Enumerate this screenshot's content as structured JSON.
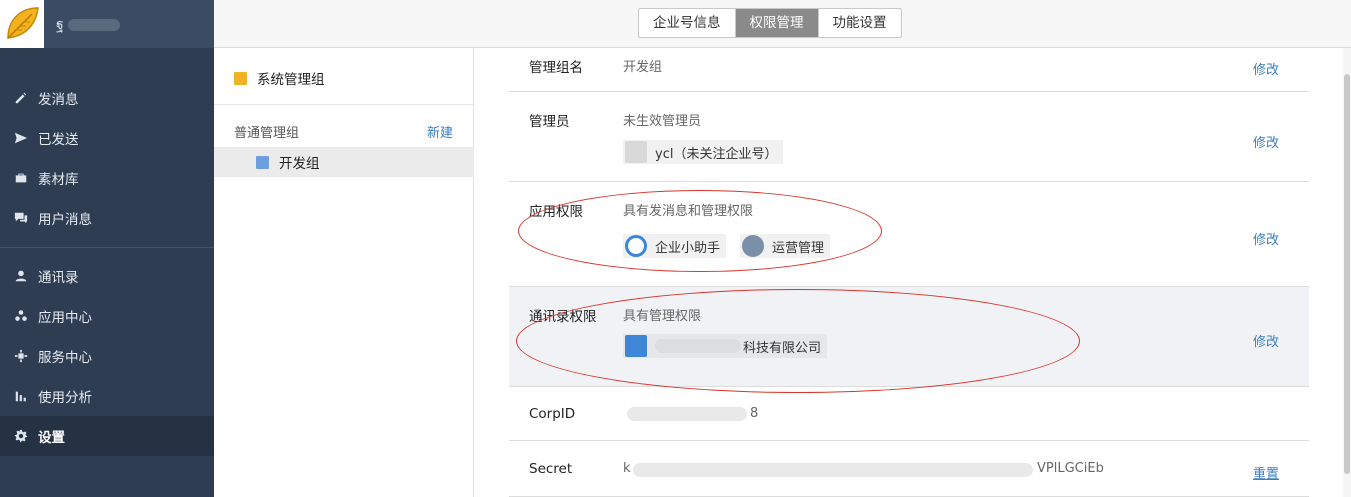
{
  "sidebar": {
    "brand_name": "ฐ",
    "nav": [
      {
        "label": "发消息",
        "icon": "pencil-icon"
      },
      {
        "label": "已发送",
        "icon": "send-icon"
      },
      {
        "label": "素材库",
        "icon": "briefcase-icon"
      },
      {
        "label": "用户消息",
        "icon": "chat-icon"
      },
      {
        "label": "通讯录",
        "icon": "person-icon"
      },
      {
        "label": "应用中心",
        "icon": "apps-icon"
      },
      {
        "label": "服务中心",
        "icon": "service-icon"
      },
      {
        "label": "使用分析",
        "icon": "bar-chart-icon"
      },
      {
        "label": "设置",
        "icon": "gear-icon",
        "active": true
      }
    ]
  },
  "tabs": [
    {
      "label": "企业号信息",
      "active": false
    },
    {
      "label": "权限管理",
      "active": true
    },
    {
      "label": "功能设置",
      "active": false
    }
  ],
  "groups": {
    "system_group": "系统管理组",
    "normal_header": "普通管理组",
    "new_label": "新建",
    "items": [
      {
        "label": "开发组"
      }
    ]
  },
  "details": {
    "group_name": {
      "label": "管理组名",
      "value": "开发组",
      "action": "修改"
    },
    "admins": {
      "label": "管理员",
      "value": "未生效管理员",
      "user_chip": "ycl（未关注企业号）",
      "action": "修改"
    },
    "app_perm": {
      "label": "应用权限",
      "value": "具有发消息和管理权限",
      "apps": [
        "企业小助手",
        "运营管理"
      ],
      "action": "修改"
    },
    "contacts_perm": {
      "label": "通讯录权限",
      "value": "具有管理权限",
      "org_chip": "科技有限公司",
      "action": "修改"
    },
    "corpid": {
      "label": "CorpID",
      "value_tail": "8"
    },
    "secret": {
      "label": "Secret",
      "value_head": "k",
      "value_tail": "VPlLGCiEb",
      "action": "重置"
    }
  },
  "colors": {
    "sidebar": "#2e3d52",
    "accent_link": "#3c7ec1",
    "annotation": "#d9342b",
    "active_tab": "#8a8a8a"
  }
}
